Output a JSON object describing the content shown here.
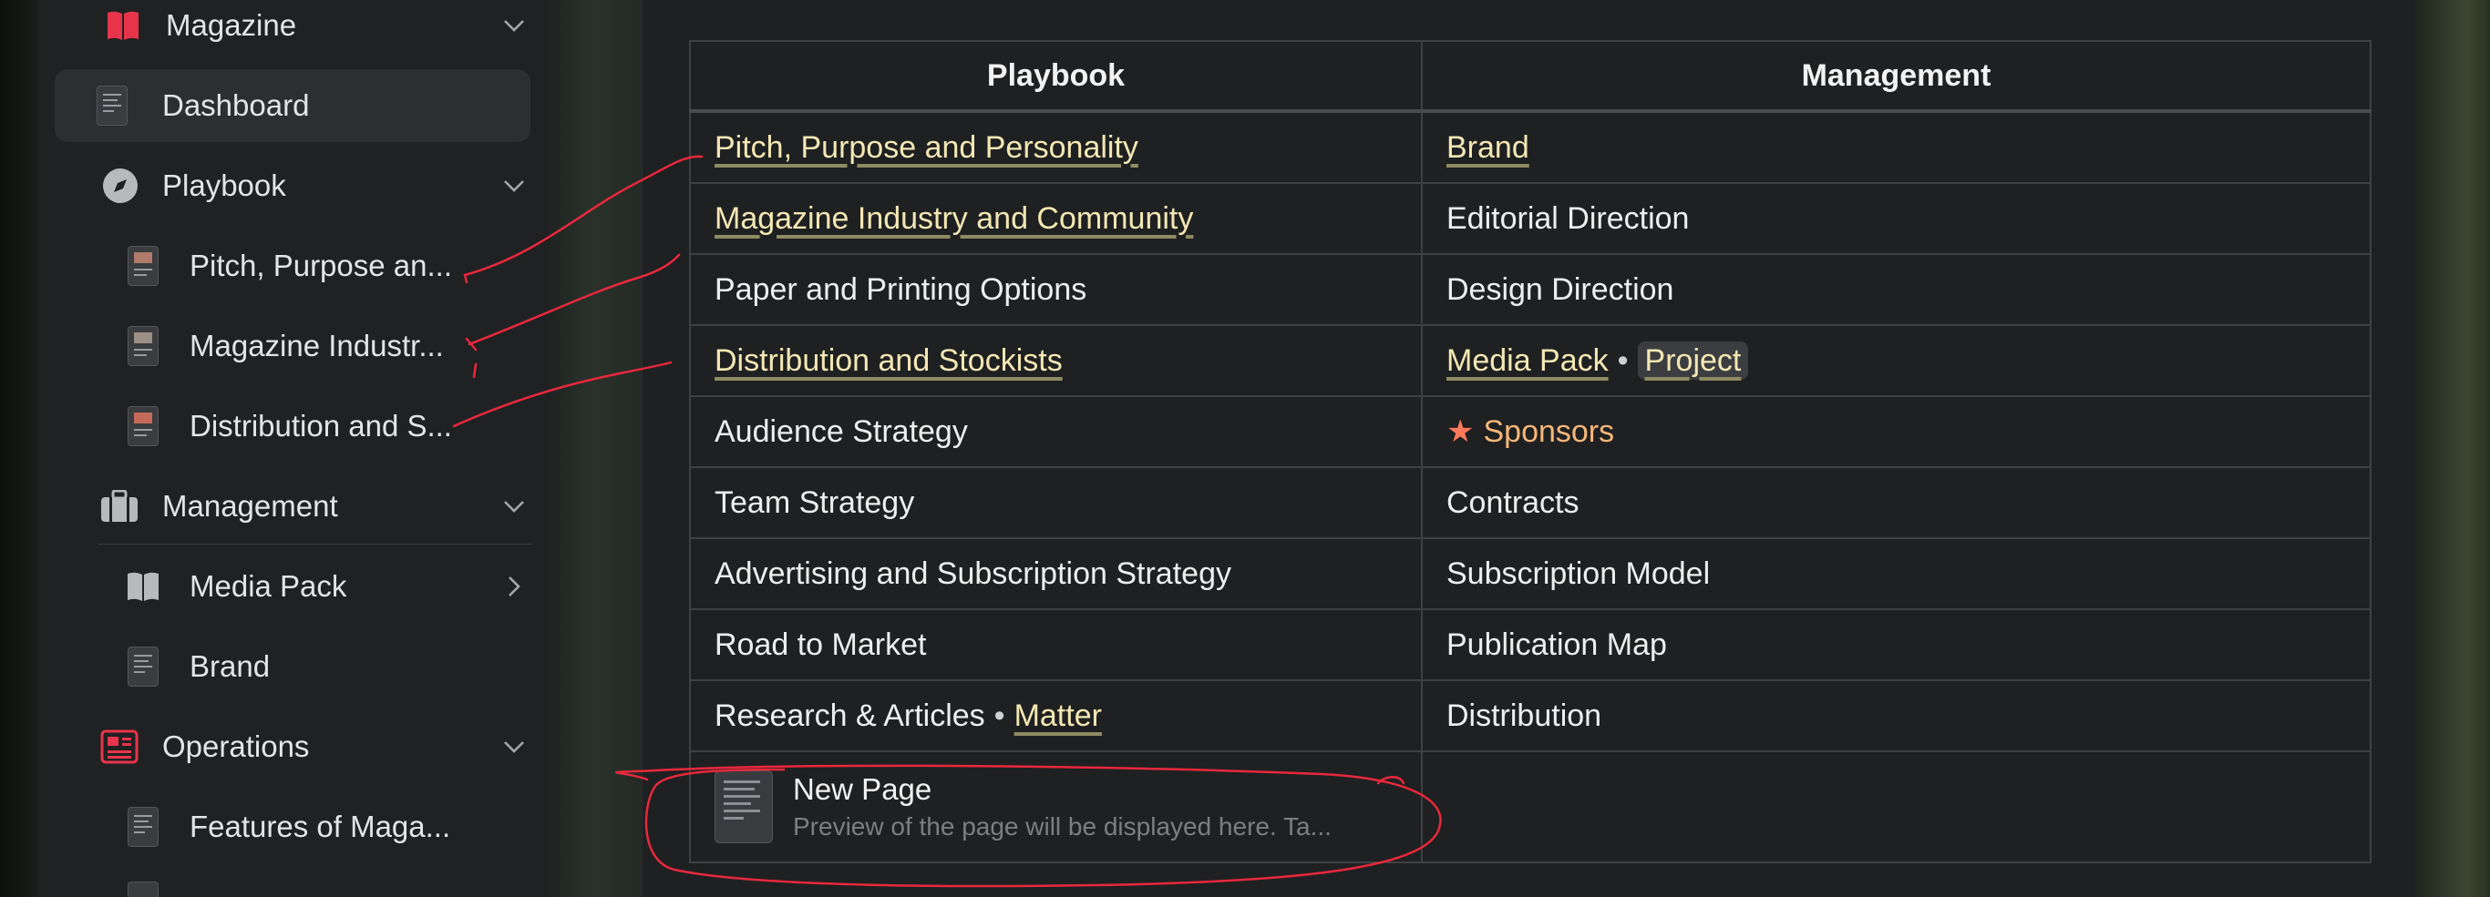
{
  "sidebar": {
    "items": [
      {
        "label": "Magazine",
        "icon": "book-icon"
      },
      {
        "label": "Dashboard",
        "icon": "document-icon"
      },
      {
        "label": "Playbook",
        "icon": "compass-icon"
      },
      {
        "label": "Pitch, Purpose an...",
        "icon": "document-image-icon"
      },
      {
        "label": "Magazine Industr...",
        "icon": "document-image-icon"
      },
      {
        "label": "Distribution and S...",
        "icon": "document-image-icon"
      },
      {
        "label": "Management",
        "icon": "briefcase-icon"
      },
      {
        "label": "Media Pack",
        "icon": "book-icon"
      },
      {
        "label": "Brand",
        "icon": "document-icon"
      },
      {
        "label": "Operations",
        "icon": "newspaper-icon"
      },
      {
        "label": "Features of Maga...",
        "icon": "document-icon"
      }
    ]
  },
  "table": {
    "headers": [
      "Playbook",
      "Management"
    ],
    "rows": [
      {
        "left": "Pitch, Purpose and Personality",
        "right": "Brand"
      },
      {
        "left": "Magazine Industry and Community",
        "right": "Editorial Direction"
      },
      {
        "left": "Paper and Printing Options",
        "right": "Design Direction"
      },
      {
        "left": "Distribution and Stockists",
        "right_a": "Media Pack",
        "right_sep": "•",
        "right_b": "Project"
      },
      {
        "left": "Audience Strategy",
        "right": "Sponsors"
      },
      {
        "left": "Team Strategy",
        "right": "Contracts"
      },
      {
        "left": "Advertising and Subscription Strategy",
        "right": "Subscription Model"
      },
      {
        "left": "Road to Market",
        "right": "Publication Map"
      },
      {
        "left_a": "Research & Articles",
        "left_sep": "•",
        "left_b": "Matter",
        "right": "Distribution"
      }
    ],
    "new_page": {
      "title": "New Page",
      "subtitle": "Preview of the page will be displayed here. Ta..."
    }
  },
  "colors": {
    "accent_red": "#e8344a",
    "link_text": "#f3e7b4",
    "sponsor_orange": "#f5b77a",
    "annotation_red": "#e8283c"
  }
}
